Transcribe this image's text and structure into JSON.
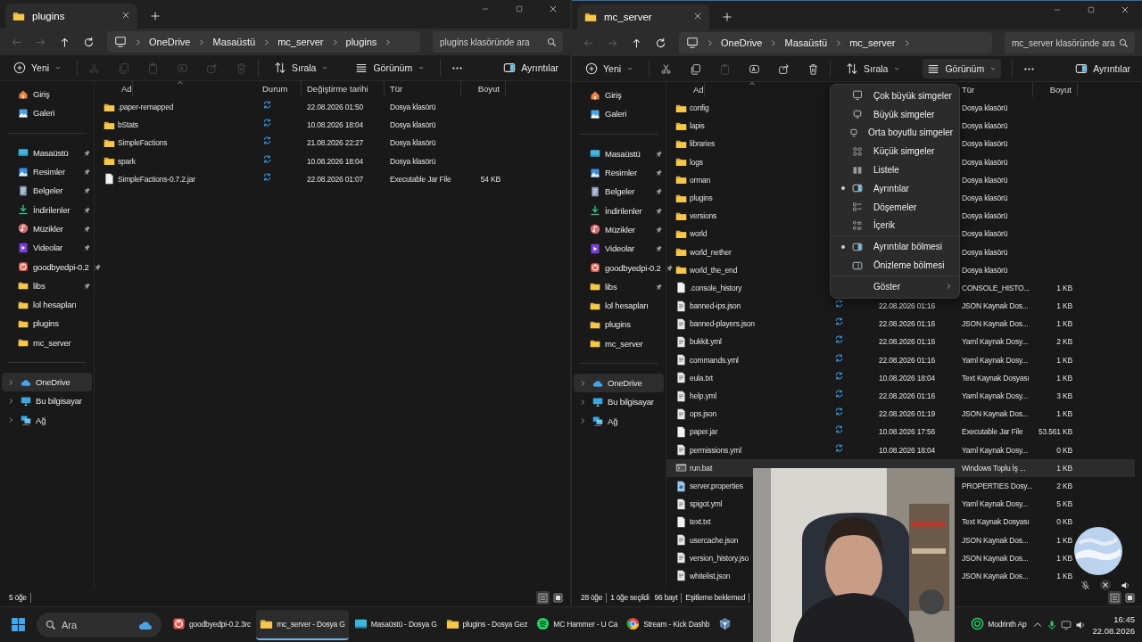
{
  "windows": [
    {
      "active": false,
      "tab": {
        "title": "plugins"
      },
      "nav": [
        {
          "kind": "back",
          "disabled": true
        },
        {
          "kind": "forward",
          "disabled": true
        },
        {
          "kind": "up",
          "disabled": false
        },
        {
          "kind": "refresh",
          "disabled": false
        }
      ],
      "breadcrumb": [
        "OneDrive",
        "Masaüstü",
        "mc_server",
        "plugins"
      ],
      "search": {
        "placeholder": "plugins klasöründe ara"
      },
      "toolbar": [
        {
          "kind": "new",
          "label": "Yeni"
        },
        {
          "kind": "cut",
          "disabled": true
        },
        {
          "kind": "copy",
          "disabled": true
        },
        {
          "kind": "paste",
          "disabled": true
        },
        {
          "kind": "rename",
          "disabled": true
        },
        {
          "kind": "share",
          "disabled": true
        },
        {
          "kind": "delete",
          "disabled": true
        },
        {
          "kind": "sort",
          "label": "Sırala"
        },
        {
          "kind": "view",
          "label": "Görünüm",
          "selected": false
        },
        {
          "kind": "more"
        },
        {
          "kind": "details",
          "label": "Ayrıntılar"
        }
      ],
      "sidebar": {
        "quick": [
          {
            "label": "Giriş",
            "kind": "home",
            "pinned": false
          },
          {
            "label": "Galeri",
            "kind": "gallery",
            "pinned": false
          }
        ],
        "pinned": [
          {
            "label": "Masaüstü",
            "kind": "desktop",
            "pinned": true
          },
          {
            "label": "Resimler",
            "kind": "pictures",
            "pinned": true
          },
          {
            "label": "Belgeler",
            "kind": "documents",
            "pinned": true
          },
          {
            "label": "İndirilenler",
            "kind": "downloads",
            "pinned": true
          },
          {
            "label": "Müzikler",
            "kind": "music",
            "pinned": true
          },
          {
            "label": "Videolar",
            "kind": "videos",
            "pinned": true
          },
          {
            "label": "goodbyedpi-0.2",
            "kind": "app",
            "pinned": true
          },
          {
            "label": "libs",
            "kind": "folder",
            "pinned": true
          },
          {
            "label": "lol hesapları",
            "kind": "folder",
            "pinned": false
          },
          {
            "label": "plugins",
            "kind": "folder",
            "pinned": false
          },
          {
            "label": "mc_server",
            "kind": "folder",
            "pinned": false
          }
        ],
        "tree": [
          {
            "label": "OneDrive",
            "kind": "cloud",
            "expanded": false,
            "selected": true
          },
          {
            "label": "Bu bilgisayar",
            "kind": "pc",
            "expanded": false,
            "selected": false
          },
          {
            "label": "Ağ",
            "kind": "network",
            "expanded": false,
            "selected": false
          }
        ]
      },
      "columns": [
        {
          "kind": "name",
          "label": "Ad"
        },
        {
          "kind": "status",
          "label": "Durum"
        },
        {
          "kind": "date",
          "label": "Değiştirme tarihi"
        },
        {
          "kind": "type",
          "label": "Tür"
        },
        {
          "kind": "size",
          "label": "Boyut"
        }
      ],
      "rows": [
        {
          "kind": "folder",
          "name": ".paper-remapped",
          "synced": true,
          "date": "22.08.2026 01:50",
          "type": "Dosya klasörü",
          "selected": false
        },
        {
          "kind": "folder",
          "name": "bStats",
          "synced": true,
          "date": "10.08.2026 18:04",
          "type": "Dosya klasörü",
          "selected": false
        },
        {
          "kind": "folder",
          "name": "SimpleFactions",
          "synced": true,
          "date": "21.08.2026 22:27",
          "type": "Dosya klasörü",
          "selected": false
        },
        {
          "kind": "folder",
          "name": "spark",
          "synced": true,
          "date": "10.08.2026 18:04",
          "type": "Dosya klasörü",
          "selected": false
        },
        {
          "kind": "file",
          "name": "SimpleFactions-0.7.2.jar",
          "synced": true,
          "date": "22.08.2026 01:07",
          "type": "Executable Jar File",
          "size": "54 KB",
          "selected": false
        }
      ],
      "status_bar": [
        [
          "5 öğe"
        ]
      ],
      "view_toggles": [
        {
          "selected": true
        },
        {
          "selected": false
        }
      ]
    },
    {
      "active": true,
      "tab": {
        "title": "mc_server"
      },
      "nav": [
        {
          "kind": "back",
          "disabled": true
        },
        {
          "kind": "forward",
          "disabled": true
        },
        {
          "kind": "up",
          "disabled": false
        },
        {
          "kind": "refresh",
          "disabled": false
        }
      ],
      "breadcrumb": [
        "OneDrive",
        "Masaüstü",
        "mc_server"
      ],
      "search": {
        "placeholder": "mc_server klasöründe ara"
      },
      "toolbar": [
        {
          "kind": "new",
          "label": "Yeni"
        },
        {
          "kind": "cut",
          "disabled": false
        },
        {
          "kind": "copy",
          "disabled": false
        },
        {
          "kind": "paste",
          "disabled": true
        },
        {
          "kind": "rename",
          "disabled": false
        },
        {
          "kind": "share",
          "disabled": false
        },
        {
          "kind": "delete",
          "disabled": false
        },
        {
          "kind": "sort",
          "label": "Sırala"
        },
        {
          "kind": "view",
          "label": "Görünüm",
          "selected": true
        },
        {
          "kind": "more"
        },
        {
          "kind": "details",
          "label": "Ayrıntılar"
        }
      ],
      "sidebar": {
        "quick": [
          {
            "label": "Giriş",
            "kind": "home",
            "pinned": false
          },
          {
            "label": "Galeri",
            "kind": "gallery",
            "pinned": false
          }
        ],
        "pinned": [
          {
            "label": "Masaüstü",
            "kind": "desktop",
            "pinned": true
          },
          {
            "label": "Resimler",
            "kind": "pictures",
            "pinned": true
          },
          {
            "label": "Belgeler",
            "kind": "documents",
            "pinned": true
          },
          {
            "label": "İndirilenler",
            "kind": "downloads",
            "pinned": true
          },
          {
            "label": "Müzikler",
            "kind": "music",
            "pinned": true
          },
          {
            "label": "Videolar",
            "kind": "videos",
            "pinned": true
          },
          {
            "label": "goodbyedpi-0.2",
            "kind": "app",
            "pinned": true
          },
          {
            "label": "libs",
            "kind": "folder",
            "pinned": true
          },
          {
            "label": "lol hesapları",
            "kind": "folder",
            "pinned": false
          },
          {
            "label": "plugins",
            "kind": "folder",
            "pinned": false
          },
          {
            "label": "mc_server",
            "kind": "folder",
            "pinned": false
          }
        ],
        "tree": [
          {
            "label": "OneDrive",
            "kind": "cloud",
            "expanded": false,
            "selected": true
          },
          {
            "label": "Bu bilgisayar",
            "kind": "pc",
            "expanded": false,
            "selected": false
          },
          {
            "label": "Ağ",
            "kind": "network",
            "expanded": false,
            "selected": false
          }
        ]
      },
      "columns": [
        {
          "kind": "name",
          "label": "Ad"
        },
        {
          "kind": "type",
          "label": "Tür"
        },
        {
          "kind": "size",
          "label": "Boyut"
        }
      ],
      "rows": [
        {
          "kind": "folder",
          "name": "config",
          "type": "Dosya klasörü",
          "selected": false
        },
        {
          "kind": "folder",
          "name": "lapis",
          "type": "Dosya klasörü",
          "selected": false
        },
        {
          "kind": "folder",
          "name": "libraries",
          "type": "Dosya klasörü",
          "selected": false
        },
        {
          "kind": "folder",
          "name": "logs",
          "type": "Dosya klasörü",
          "selected": false
        },
        {
          "kind": "folder",
          "name": "orman",
          "type": "Dosya klasörü",
          "selected": false
        },
        {
          "kind": "folder",
          "name": "plugins",
          "type": "Dosya klasörü",
          "selected": false
        },
        {
          "kind": "folder",
          "name": "versions",
          "type": "Dosya klasörü",
          "selected": false
        },
        {
          "kind": "folder",
          "name": "world",
          "type": "Dosya klasörü",
          "selected": false
        },
        {
          "kind": "folder",
          "name": "world_nether",
          "type": "Dosya klasörü",
          "selected": false
        },
        {
          "kind": "folder",
          "name": "world_the_end",
          "type": "Dosya klasörü",
          "selected": false
        },
        {
          "kind": "file",
          "name": ".console_history",
          "type": "CONSOLE_HISTO...",
          "size": "1 KB",
          "selected": false
        },
        {
          "kind": "text",
          "name": "banned-ips.json",
          "synced": true,
          "date": "22.08.2026 01:16",
          "type": "JSON Kaynak Dos...",
          "size": "1 KB",
          "selected": false
        },
        {
          "kind": "text",
          "name": "banned-players.json",
          "synced": true,
          "date": "22.08.2026 01:16",
          "type": "JSON Kaynak Dos...",
          "size": "1 KB",
          "selected": false
        },
        {
          "kind": "text",
          "name": "bukkit.yml",
          "synced": true,
          "date": "22.08.2026 01:16",
          "type": "Yaml Kaynak Dosy...",
          "size": "2 KB",
          "selected": false
        },
        {
          "kind": "text",
          "name": "commands.yml",
          "synced": true,
          "date": "22.08.2026 01:16",
          "type": "Yaml Kaynak Dosy...",
          "size": "1 KB",
          "selected": false
        },
        {
          "kind": "text",
          "name": "eula.txt",
          "synced": true,
          "date": "10.08.2026 18:04",
          "type": "Text Kaynak Dosyası",
          "size": "1 KB",
          "selected": false
        },
        {
          "kind": "text",
          "name": "help.yml",
          "synced": true,
          "date": "22.08.2026 01:16",
          "type": "Yaml Kaynak Dosy...",
          "size": "3 KB",
          "selected": false
        },
        {
          "kind": "text",
          "name": "ops.json",
          "synced": true,
          "date": "22.08.2026 01:19",
          "type": "JSON Kaynak Dos...",
          "size": "1 KB",
          "selected": false
        },
        {
          "kind": "file",
          "name": "paper.jar",
          "synced": true,
          "date": "10.08.2026 17:56",
          "type": "Executable Jar File",
          "size": "53.561 KB",
          "selected": false
        },
        {
          "kind": "text",
          "name": "permissions.yml",
          "synced": true,
          "date": "10.08.2026 18:04",
          "type": "Yaml Kaynak Dosy...",
          "size": "0 KB",
          "selected": false
        },
        {
          "kind": "script",
          "name": "run.bat",
          "type": "Windows Toplu İş ...",
          "size": "1 KB",
          "selected": true
        },
        {
          "kind": "config",
          "name": "server.properties",
          "type": "PROPERTIES Dosy...",
          "size": "2 KB",
          "selected": false
        },
        {
          "kind": "text",
          "name": "spigot.yml",
          "type": "Yaml Kaynak Dosy...",
          "size": "5 KB",
          "selected": false
        },
        {
          "kind": "file",
          "name": "text.txt",
          "type": "Text Kaynak Dosyası",
          "size": "0 KB",
          "selected": false
        },
        {
          "kind": "text",
          "name": "usercache.json",
          "type": "JSON Kaynak Dos...",
          "size": "1 KB",
          "selected": false
        },
        {
          "kind": "text",
          "name": "version_history.jso",
          "type": "JSON Kaynak Dos...",
          "size": "1 KB",
          "selected": false
        },
        {
          "kind": "text",
          "name": "whitelist.json",
          "type": "JSON Kaynak Dos...",
          "size": "1 KB",
          "selected": false
        }
      ],
      "status_bar": [
        [
          "28 öğe"
        ],
        [
          "1 öğe seçildi",
          "96 bayt"
        ],
        [
          "Eşitleme beklemed"
        ]
      ],
      "view_toggles": [
        {
          "selected": true
        },
        {
          "selected": false
        }
      ]
    }
  ],
  "view_menu": {
    "items": [
      {
        "kind": "view",
        "label": "Çok büyük simgeler",
        "selected": false
      },
      {
        "kind": "view",
        "label": "Büyük simgeler",
        "selected": false
      },
      {
        "kind": "view",
        "label": "Orta boyutlu simgeler",
        "selected": false
      },
      {
        "kind": "view",
        "label": "Küçük simgeler",
        "selected": false
      },
      {
        "kind": "view",
        "label": "Listele",
        "selected": false
      },
      {
        "kind": "view",
        "label": "Ayrıntılar",
        "selected": true
      },
      {
        "kind": "view",
        "label": "Döşemeler",
        "selected": false
      },
      {
        "kind": "view",
        "label": "İçerik",
        "selected": false
      },
      {
        "kind": "pane",
        "label": "Ayrıntılar bölmesi",
        "selected": true
      },
      {
        "kind": "pane",
        "label": "Önizleme bölmesi",
        "selected": false
      },
      {
        "kind": "submenu",
        "label": "Göster"
      }
    ]
  },
  "taskbar": {
    "search": {
      "placeholder": "Ara"
    },
    "apps": [
      {
        "kind": "app",
        "label": "goodbyedpi-0.2.3rc",
        "active": false
      },
      {
        "kind": "folder",
        "label": "mc_server - Dosya G",
        "active": true
      },
      {
        "kind": "desktop",
        "label": "Masaüstü - Dosya G",
        "active": false
      },
      {
        "kind": "folder",
        "label": "plugins - Dosya Gez",
        "active": false
      },
      {
        "kind": "music-app",
        "label": "MC Hammer - U Ca",
        "active": false
      },
      {
        "kind": "browser",
        "label": "Stream - Kick Dashb",
        "active": false
      },
      {
        "kind": "cube",
        "active": false
      }
    ],
    "right_apps": [
      {
        "kind": "modrinth",
        "label": "Modrinth Ap",
        "active": false
      }
    ],
    "time": "16:45",
    "date": "22.08.2026"
  }
}
